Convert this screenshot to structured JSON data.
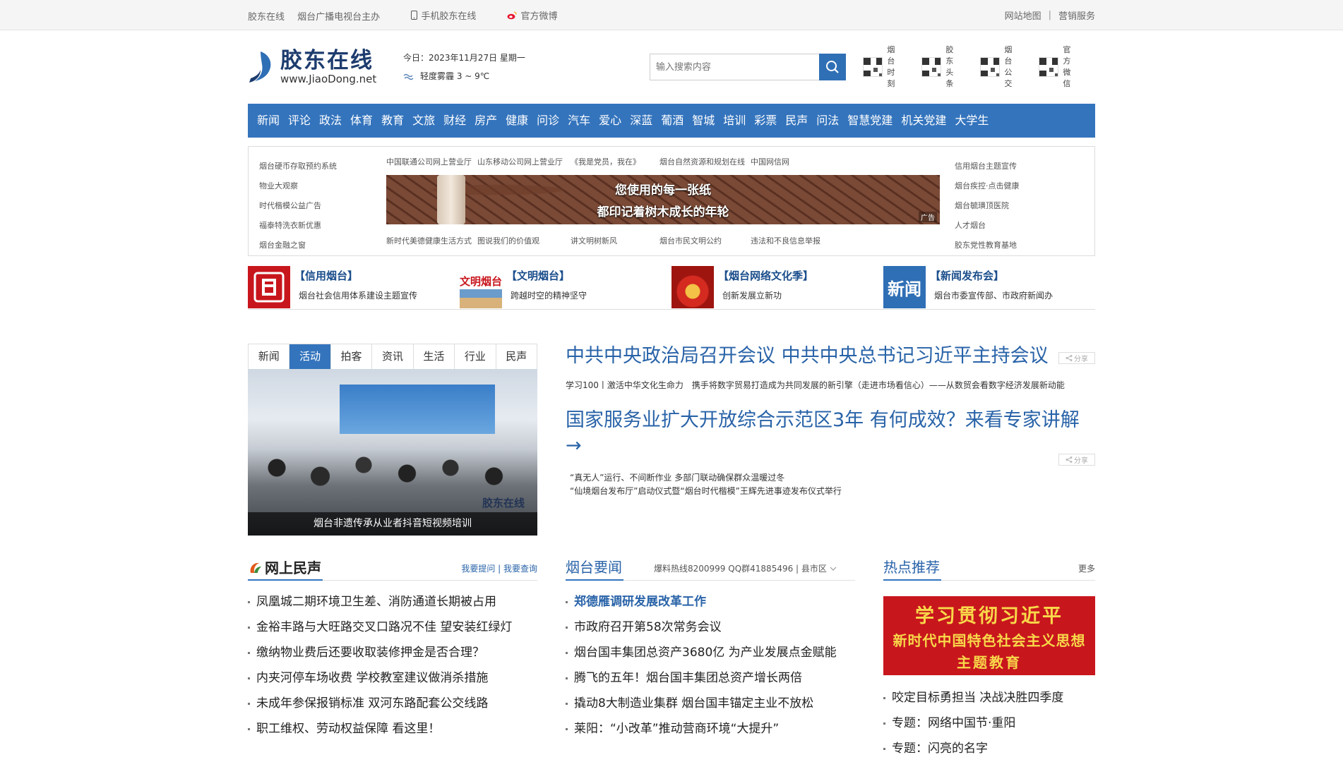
{
  "topbar": {
    "site": "胶东在线",
    "host": "烟台广播电视台主办",
    "mobile": "手机胶东在线",
    "weibo": "官方微博",
    "sitemap": "网站地图",
    "sep": "|",
    "marketing": "营销服务"
  },
  "header": {
    "logo_cn": "胶东在线",
    "logo_en": "www.JiaoDong.net",
    "date": "今日：2023年11月27日 星期一",
    "weather": "轻度雾霾 3 ~ 9℃",
    "search_placeholder": "输入搜索内容",
    "qrs": [
      {
        "label": "烟台时刻"
      },
      {
        "label": "胶东头条"
      },
      {
        "label": "烟台公交"
      },
      {
        "label": "官方微信"
      }
    ]
  },
  "nav": [
    "新闻",
    "评论",
    "政法",
    "体育",
    "教育",
    "文旅",
    "财经",
    "房产",
    "健康",
    "问诊",
    "汽车",
    "爱心",
    "深蓝",
    "葡酒",
    "智城",
    "培训",
    "彩票",
    "民声",
    "问法",
    "智慧党建",
    "机关党建",
    "大学生"
  ],
  "links": {
    "left": [
      "烟台硬币存取预约系统",
      "物业大观察",
      "时代楷模公益广告",
      "福泰特洗衣新优惠",
      "烟台金融之窗"
    ],
    "top": [
      "中国联通公司网上营业厅",
      "山东移动公司网上营业厅",
      "《我是党员，我在》",
      "烟台自然资源和规划在线",
      "中国网信网"
    ],
    "bottom": [
      "新时代美德健康生活方式",
      "图说我们的价值观",
      "讲文明树新风",
      "烟台市民文明公约",
      "违法和不良信息举报"
    ],
    "right": [
      "信用烟台主题宣传",
      "烟台疾控·点击健康",
      "烟台毓璜顶医院",
      "人才烟台",
      "胶东党性教育基地"
    ],
    "ad_line1": "您使用的每一张纸",
    "ad_line2": "都印记着树木成长的年轮",
    "ad_tag": "广告"
  },
  "promos": [
    {
      "title": "【信用烟台】",
      "desc": "烟台社会信用体系建设主题宣传"
    },
    {
      "title": "【文明烟台】",
      "desc": "跨越时空的精神坚守",
      "thumb_text": "文明烟台"
    },
    {
      "title": "【烟台网络文化季】",
      "desc": "创新发展立新功"
    },
    {
      "title": "【新闻发布会】",
      "desc": "烟台市委宣传部、市政府新闻办",
      "thumb_text": "新闻"
    }
  ],
  "tabs": [
    "新闻",
    "活动",
    "拍客",
    "资讯",
    "生活",
    "行业",
    "民声"
  ],
  "photo": {
    "caption": "烟台非遗传承从业者抖音短视频培训",
    "watermark": "胶东在线"
  },
  "headlines": {
    "h1": "中共中央政治局召开会议 中共中央总书记习近平主持会议",
    "h1_sub": "学习100丨激活中华文化生命力　携手将数字贸易打造成为共同发展的新引擎（走进市场看信心）——从数贸会看数字经济发展新动能",
    "h2": "国家服务业扩大开放综合示范区3年 有何成效？来看专家讲解→",
    "h2_sub1": "“真无人”运行、不间断作业 多部门联动确保群众温暖过冬",
    "h2_sub2": "“仙境烟台发布厅”启动仪式暨“烟台时代楷模”王辉先进事迹发布仪式举行",
    "share": "分享"
  },
  "minsheng": {
    "title": "网上民声",
    "links": "我要提问 | 我要查询",
    "items": [
      "凤凰城二期环境卫生差、消防通道长期被占用",
      "金裕丰路与大旺路交叉口路况不佳 望安装红绿灯",
      "缴纳物业费后还要收取装修押金是否合理？",
      "内夹河停车场收费 学校教室建议做消杀措施",
      "未成年参保报销标准 双河东路配套公交线路",
      "职工维权、劳动权益保障 看这里！"
    ]
  },
  "yaowen": {
    "title": "烟台要闻",
    "hotline": "爆料热线8200999 QQ群41885496 | 县市区",
    "items": [
      "郑德雁调研发展改革工作",
      "市政府召开第58次常务会议",
      "烟台国丰集团总资产3680亿 为产业发展点金赋能",
      "腾飞的五年！烟台国丰集团总资产增长两倍",
      "撬动8大制造业集群 烟台国丰锚定主业不放松",
      "莱阳：“小改革”推动营商环境“大提升”"
    ]
  },
  "hot": {
    "title": "热点推荐",
    "more": "更多",
    "img_l1": "学习贯彻习近平",
    "img_l2": "新时代中国特色社会主义思想",
    "img_l3": "主题教育",
    "items": [
      "咬定目标勇担当 决战决胜四季度",
      "专题：网络中国节·重阳",
      "专题：闪亮的名字"
    ]
  },
  "colors": {
    "brand_blue": "#3474bd",
    "link_blue": "#2963a8",
    "ad_red": "#c8161d"
  }
}
